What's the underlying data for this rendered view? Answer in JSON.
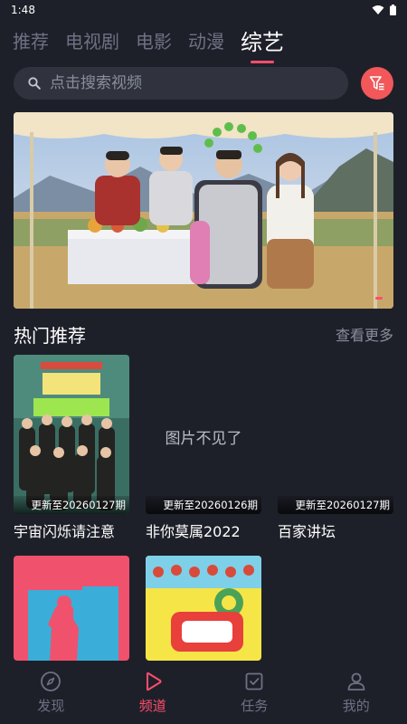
{
  "status": {
    "time": "1:48"
  },
  "tabs": [
    {
      "label": "推荐",
      "active": false
    },
    {
      "label": "电视剧",
      "active": false
    },
    {
      "label": "电影",
      "active": false
    },
    {
      "label": "动漫",
      "active": false
    },
    {
      "label": "综艺",
      "active": true
    }
  ],
  "search": {
    "placeholder": "点击搜索视频"
  },
  "section": {
    "title": "热门推荐",
    "more": "查看更多"
  },
  "cards": [
    {
      "title": "宇宙闪烁请注意",
      "badge": "更新至20260127期",
      "image_missing": false
    },
    {
      "title": "非你莫属2022",
      "badge": "更新至20260126期",
      "image_missing": true,
      "missing_text": "图片不见了"
    },
    {
      "title": "百家讲坛",
      "badge": "更新至20260127期",
      "image_missing": true
    }
  ],
  "bottom_nav": [
    {
      "label": "发现",
      "icon": "compass-icon",
      "active": false
    },
    {
      "label": "频道",
      "icon": "play-icon",
      "active": true
    },
    {
      "label": "任务",
      "icon": "task-icon",
      "active": false
    },
    {
      "label": "我的",
      "icon": "user-icon",
      "active": false
    }
  ],
  "colors": {
    "accent": "#ff4d6d",
    "background": "#1e2029",
    "filter_button": "#f2575a"
  }
}
